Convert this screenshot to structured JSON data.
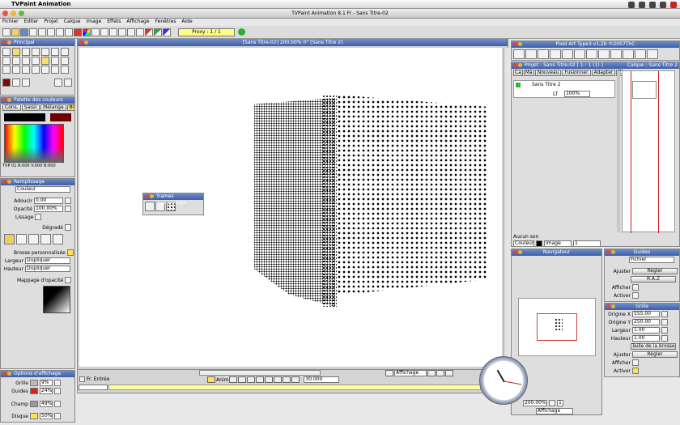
{
  "menubar": {
    "app": "TVPaint Animation"
  },
  "window": {
    "title": "TVPaint Animation 8.1 Fr - Sans Titre-02"
  },
  "menu": [
    "Fichier",
    "Editer",
    "Projet",
    "Calque",
    "Image",
    "Effets",
    "Affichage",
    "Fenêtres",
    "Aide"
  ],
  "toolbar": {
    "proxy": "Proxy : 1 / 1"
  },
  "principal": {
    "title": "Principal"
  },
  "palette": {
    "title": "Palette des couleurs",
    "tabs": [
      "Cons.",
      "Saisir",
      "Mélange",
      "Bin"
    ],
    "readout": "TVP 01 R:000 V:000 B:000"
  },
  "remplissage": {
    "title": "Remplissage",
    "mode": "Couleur",
    "adoucir_label": "Adoucir",
    "adoucir": "0.00",
    "opacite_label": "Opacité",
    "opacite": "100.00%",
    "lissage": "Lissage",
    "degrade": "Dégradé",
    "brosse": "Brosse personnalisée",
    "largeur_label": "Largeur",
    "largeur": "Dupliquer",
    "hauteur_label": "Hauteur",
    "hauteur": "Dupliquer",
    "mappage": "Mappage d'opacité"
  },
  "trames": {
    "title": "Trames mécaniques"
  },
  "canvas": {
    "title": "[Sans Titre-02]  200.00%  0°  [Sans Titre 2]"
  },
  "affichage": {
    "title": "Options d'affichage",
    "rows": [
      {
        "label": "Grille",
        "value": "9%"
      },
      {
        "label": "Guides",
        "value": "24%"
      },
      {
        "label": "Champ",
        "value": "49%"
      },
      {
        "label": "Disque",
        "value": "50%"
      }
    ]
  },
  "timeline": {
    "mode": "Fr. Entrée",
    "anim": "Anim",
    "fps": "30.000",
    "affichage": "Affichage"
  },
  "pixelart": {
    "title": "Pixel Art Type3 v1.2b ©2007ThC"
  },
  "projet": {
    "title": "Projet : Sans Titre-02 [ 1 : 1 (1) ]",
    "calque_title": "Calque : Sans Titre 2",
    "headers": [
      "Ca",
      "Ma",
      "Nouveau",
      "Fusionner",
      "Adapter",
      "Z"
    ],
    "layer": "Sans Titre 2",
    "lt": "LT",
    "opacity": "100%",
    "aucun_son": "Aucun son",
    "couleur": "Couleur",
    "image": "Image",
    "frame": "1"
  },
  "navigator": {
    "title": "Navigateur",
    "zoom": "200.00%",
    "affichage": "Affichage",
    "page": "1"
  },
  "guides": {
    "title": "Guides",
    "fichier": "Fichier",
    "ajuster": "Ajuster",
    "regler": "Régler",
    "raz": "R.A.Z",
    "afficher": "Afficher",
    "activer": "Activer"
  },
  "grille": {
    "title": "Grille",
    "ox_label": "Origine X",
    "ox": "555.00",
    "oy_label": "Origine Y",
    "oy": "250.00",
    "l_label": "Largeur",
    "l": "1.00",
    "h_label": "Hauteur",
    "h": "1.00",
    "taille": "Taille de la brosse",
    "ajuster": "Ajuster",
    "regler": "Régler",
    "afficher": "Afficher",
    "activer": "Activer"
  }
}
